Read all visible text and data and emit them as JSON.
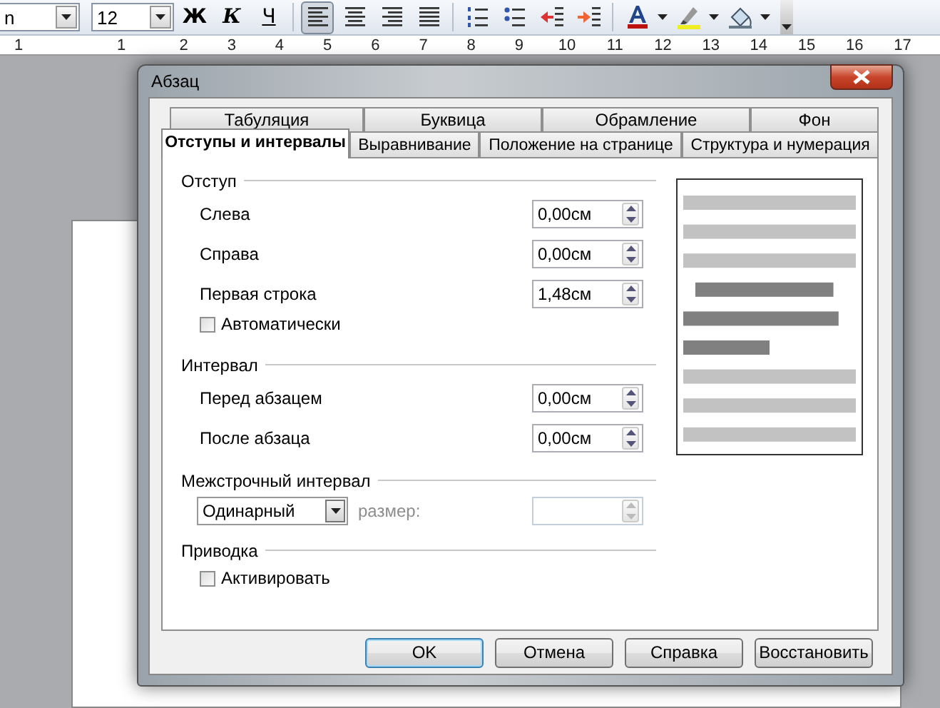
{
  "toolbar": {
    "font_name": "n",
    "font_size": "12",
    "buttons": [
      {
        "kind": "bold",
        "label": "Ж",
        "selected": false
      },
      {
        "kind": "italic",
        "label": "К",
        "selected": false
      },
      {
        "kind": "underline",
        "label": "Ч",
        "selected": false
      },
      {
        "kind": "align_left",
        "selected": true
      },
      {
        "kind": "align_center",
        "selected": false
      },
      {
        "kind": "align_right",
        "selected": false
      },
      {
        "kind": "justify",
        "selected": false
      },
      {
        "kind": "numbering",
        "selected": false
      },
      {
        "kind": "bullets",
        "selected": false
      },
      {
        "kind": "outdent",
        "selected": false
      },
      {
        "kind": "indent",
        "selected": false
      },
      {
        "kind": "font_color",
        "selected": false
      },
      {
        "kind": "highlight",
        "selected": false
      },
      {
        "kind": "shading",
        "selected": false
      }
    ]
  },
  "ruler": {
    "labels": [
      "1",
      "1",
      "2",
      "3",
      "4",
      "5",
      "6",
      "7",
      "8",
      "9",
      "10",
      "11",
      "12",
      "13",
      "14",
      "15",
      "16",
      "17"
    ]
  },
  "dialog": {
    "title": "Абзац",
    "tabs_row_1": [
      {
        "label": "Табуляция",
        "selected": false
      },
      {
        "label": "Буквица",
        "selected": false
      },
      {
        "label": "Обрамление",
        "selected": false
      },
      {
        "label": "Фон",
        "selected": false
      }
    ],
    "tabs_row_2": [
      {
        "label": "Отступы и интервалы",
        "selected": true
      },
      {
        "label": "Выравнивание",
        "selected": false
      },
      {
        "label": "Положение на странице",
        "selected": false
      },
      {
        "label": "Структура и нумерация",
        "selected": false
      }
    ],
    "sections": [
      {
        "title": "Отступ",
        "rows": [
          {
            "kind": "spin",
            "label": "Слева",
            "value": "0,00см"
          },
          {
            "kind": "spin",
            "label": "Справа",
            "value": "0,00см"
          },
          {
            "kind": "spin",
            "label": "Первая строка",
            "value": "1,48см"
          },
          {
            "kind": "checkbox",
            "label": "Автоматически",
            "checked": false
          }
        ]
      },
      {
        "title": "Интервал",
        "rows": [
          {
            "kind": "spin",
            "label": "Перед абзацем",
            "value": "0,00см"
          },
          {
            "kind": "spin",
            "label": "После абзаца",
            "value": "0,00см"
          }
        ]
      },
      {
        "title": "Межстрочный интервал",
        "rows": [
          {
            "kind": "dropdown",
            "value": "Одинарный",
            "label": "размер:",
            "disabled": true
          }
        ]
      },
      {
        "title": "Приводка",
        "rows": [
          {
            "kind": "checkbox",
            "label": "Активировать",
            "checked": false
          }
        ]
      }
    ],
    "buttons": [
      {
        "label": "OK",
        "default": true
      },
      {
        "label": "Отмена",
        "default": false
      },
      {
        "label": "Справка",
        "default": false
      },
      {
        "label": "Восстановить",
        "default": false
      }
    ]
  }
}
